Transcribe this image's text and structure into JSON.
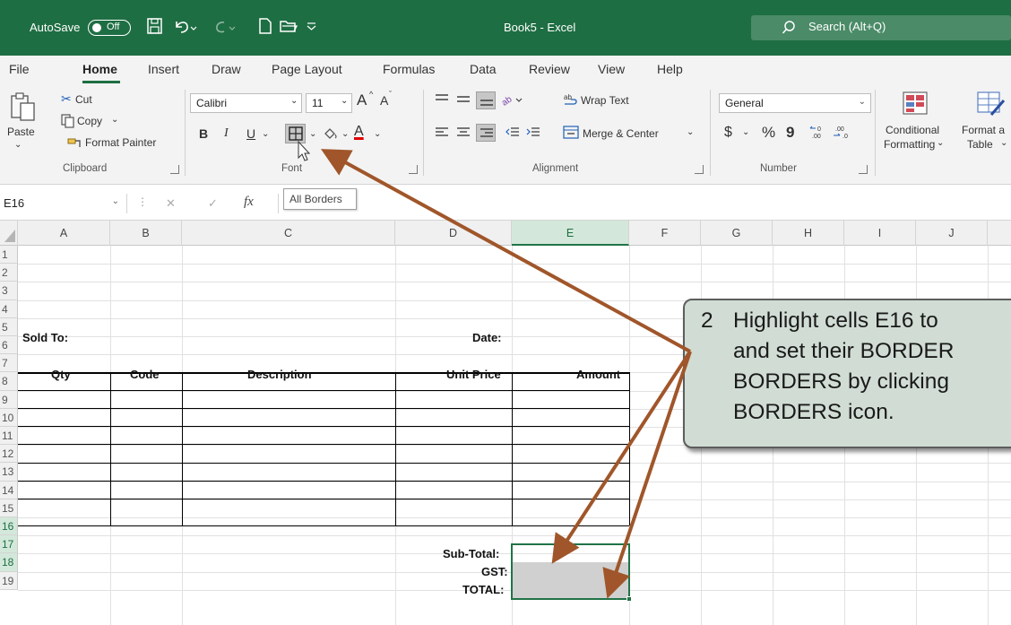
{
  "titlebar": {
    "autosave_label": "AutoSave",
    "autosave_state": "Off",
    "document_title": "Book5  -  Excel",
    "search_placeholder": "Search (Alt+Q)"
  },
  "tabs": [
    "File",
    "Home",
    "Insert",
    "Draw",
    "Page Layout",
    "Formulas",
    "Data",
    "Review",
    "View",
    "Help"
  ],
  "ribbon": {
    "clipboard": {
      "paste": "Paste",
      "cut": "Cut",
      "copy": "Copy",
      "format_painter": "Format Painter",
      "label": "Clipboard"
    },
    "font": {
      "name": "Calibri",
      "size": "11",
      "bold": "B",
      "italic": "I",
      "underline": "U",
      "label": "Font",
      "grow": "A",
      "shrink": "A",
      "font_color": "A"
    },
    "alignment": {
      "wrap_text": "Wrap Text",
      "merge_center": "Merge & Center",
      "label": "Alignment"
    },
    "number": {
      "format": "General",
      "currency": "$",
      "percent": "%",
      "comma": "9",
      "label": "Number"
    },
    "styles": {
      "conditional_1": "Conditional",
      "conditional_2": "Formatting",
      "format_table_1": "Format a",
      "format_table_2": "Table"
    }
  },
  "tooltip": "All Borders",
  "formula_bar": {
    "name_box": "E16",
    "fx": "fx",
    "cancel": "✕",
    "enter": "✓"
  },
  "sheet": {
    "columns": [
      "A",
      "B",
      "C",
      "D",
      "E",
      "F",
      "G",
      "H",
      "I",
      "J"
    ],
    "rows": [
      "1",
      "2",
      "3",
      "4",
      "5",
      "6",
      "7",
      "8",
      "9",
      "10",
      "11",
      "12",
      "13",
      "14",
      "15",
      "16",
      "17",
      "18",
      "19"
    ],
    "cells": {
      "sold_to": "Sold To:",
      "date": "Date:",
      "qty": "Qty",
      "code": "Code",
      "description": "Description",
      "unit_price": "Unit Price",
      "amount": "Amount",
      "sub_total": "Sub-Total:",
      "gst": "GST:",
      "total": "TOTAL:"
    }
  },
  "callout": {
    "number": "2",
    "text": "Highlight cells E16 to\nand set their BORDER\nBORDERS by clicking \nBORDERS icon."
  },
  "colors": {
    "excel_green": "#1e6e43",
    "callout_fill": "#d1ddd4",
    "arrow": "#a0562a"
  }
}
